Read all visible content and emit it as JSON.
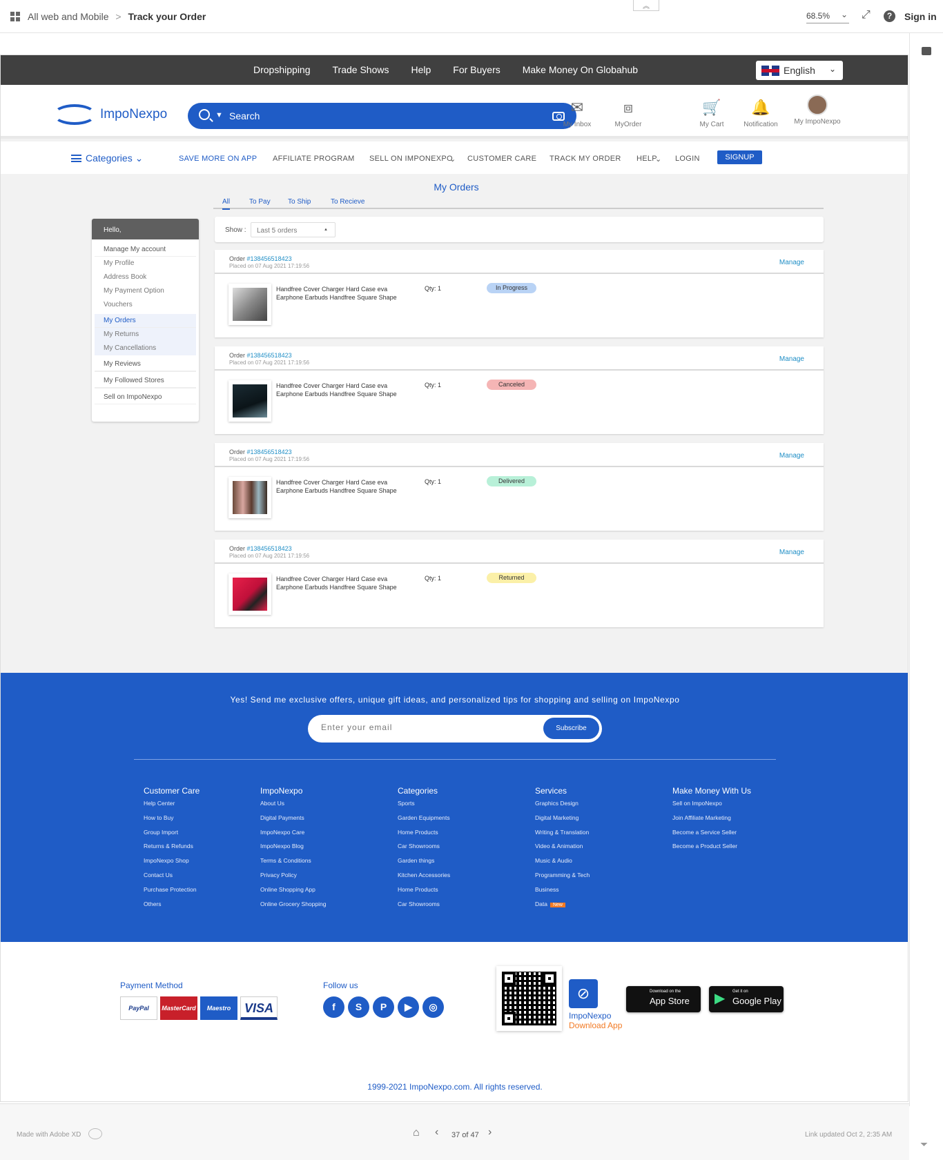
{
  "xd": {
    "breadcrumb_parent": "All web and Mobile",
    "breadcrumb_sep": ">",
    "breadcrumb_current": "Track your Order",
    "zoom": "68.5%",
    "sign_in": "Sign in",
    "made_with": "Made with Adobe XD",
    "page_counter": "37 of 47",
    "link_updated": "Link updated Oct 2, 2:35 AM"
  },
  "topnav": {
    "links": [
      "Dropshipping",
      "Trade Shows",
      "Help",
      "For Buyers",
      "Make Money On Globahub"
    ],
    "language": "English"
  },
  "header": {
    "brand": "ImpoNexpo",
    "search_placeholder": "Search",
    "icons": [
      {
        "label": "My Inbox",
        "icon": "mail-icon"
      },
      {
        "label": "MyOrder",
        "icon": "box-icon"
      },
      {
        "label": "My Cart",
        "icon": "cart-icon"
      },
      {
        "label": "Notification",
        "icon": "bell-icon"
      },
      {
        "label": "My ImpoNexpo",
        "icon": "avatar"
      }
    ]
  },
  "catnav": {
    "categories": "Categories",
    "items": [
      "SAVE MORE ON APP",
      "AFFILIATE PROGRAM",
      "SELL ON IMPONEXPO",
      "CUSTOMER CARE",
      "TRACK MY ORDER",
      "HELP",
      "LOGIN"
    ],
    "signup": "SIGNUP"
  },
  "main": {
    "title": "My Orders",
    "tabs": [
      "All",
      "To Pay",
      "To Ship",
      "To Recieve"
    ],
    "show_label": "Show :",
    "show_value": "Last 5 orders"
  },
  "sidebar": {
    "hello": "Hello,",
    "manage": "Manage My account",
    "account_items": [
      "My Profile",
      "Address Book",
      "My Payment Option",
      "Vouchers"
    ],
    "orders": "My Orders",
    "order_items": [
      "My Returns",
      "My Cancellations"
    ],
    "reviews": "My Reviews",
    "followed": "My Followed Stores",
    "sell": "Sell on ImpoNexpo"
  },
  "orders": [
    {
      "prefix": "Order ",
      "number": "#138456518423",
      "placed": "Placed on 07 Aug 2021 17:19:56",
      "manage": "Manage",
      "product": "Handfree Cover Charger Hard Case eva Earphone Earbuds Handfree Square Shape",
      "qty": "Qty: 1",
      "status": "In Progress",
      "status_color": "#b9d3f5"
    },
    {
      "prefix": "Order ",
      "number": "#138456518423",
      "placed": "Placed on 07 Aug 2021 17:19:56",
      "manage": "Manage",
      "product": "Handfree Cover Charger Hard Case eva Earphone Earbuds Handfree Square Shape",
      "qty": "Qty: 1",
      "status": "Canceled",
      "status_color": "#f5b5b5"
    },
    {
      "prefix": "Order ",
      "number": "#138456518423",
      "placed": "Placed on 07 Aug 2021 17:19:56",
      "manage": "Manage",
      "product": "Handfree Cover Charger Hard Case eva Earphone Earbuds Handfree Square Shape",
      "qty": "Qty: 1",
      "status": "Delivered",
      "status_color": "#b8f0d8"
    },
    {
      "prefix": "Order ",
      "number": "#138456518423",
      "placed": "Placed on 07 Aug 2021 17:19:56",
      "manage": "Manage",
      "product": "Handfree Cover Charger Hard Case eva Earphone Earbuds Handfree Square Shape",
      "qty": "Qty: 1",
      "status": "Returned",
      "status_color": "#fbf0a8"
    }
  ],
  "footer": {
    "offer": "Yes! Send me exclusive offers, unique gift ideas, and personalized tips for shopping and selling on ImpoNexpo",
    "email_placeholder": "Enter your email",
    "subscribe": "Subscribe",
    "columns": [
      {
        "title": "Customer Care",
        "items": [
          "Help Center",
          "How to Buy",
          "Group Import",
          "Returns & Refunds",
          "ImpoNexpo Shop",
          "Contact Us",
          "Purchase Protection",
          "Others"
        ]
      },
      {
        "title": "ImpoNexpo",
        "items": [
          "About Us",
          "Digital Payments",
          "ImpoNexpo Care",
          "ImpoNexpo Blog",
          "Terms & Conditions",
          "Privacy Policy",
          "Online Shopping App",
          "Online Grocery Shopping"
        ]
      },
      {
        "title": "Categories",
        "items": [
          "Sports",
          "Garden Equipments",
          "Home Products",
          "Car Showrooms",
          "Garden things",
          "Kitchen Accessories",
          "Home Products",
          "Car Showrooms"
        ]
      },
      {
        "title": "Services",
        "items": [
          "Graphics Design",
          "Digital Marketing",
          "Writing & Translation",
          "Video & Animation",
          "Music & Audio",
          "Programming & Tech",
          "Business",
          "Data"
        ]
      },
      {
        "title": "Make Money With Us",
        "items": [
          "Sell on ImpoNexpo",
          "Join Affiliate Marketing",
          "Become a Service Seller",
          "Become a Product Seller"
        ]
      }
    ],
    "new_badge": "New"
  },
  "bottom": {
    "payment_title": "Payment Method",
    "payments": [
      "PayPal",
      "MasterCard",
      "Maestro",
      "VISA"
    ],
    "follow_title": "Follow us",
    "socials": [
      "facebook-icon",
      "skype-icon",
      "pinterest-icon",
      "play-icon",
      "instagram-icon"
    ],
    "app_name": "ImpoNexpo",
    "download_app": "Download App",
    "appstore_small": "Download on the",
    "appstore_large": "App Store",
    "play_small": "Get it on",
    "play_large": "Google Play",
    "copyright": "1999-2021 ImpoNexpo.com. All rights reserved."
  }
}
